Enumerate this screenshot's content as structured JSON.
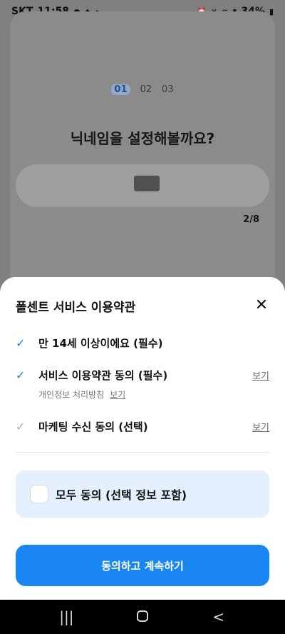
{
  "status_bar": {
    "carrier": "SKT",
    "time": "11:58",
    "battery": "34%"
  },
  "background_page": {
    "steps": [
      "01",
      "02",
      "03"
    ],
    "title": "닉네임을 설정해볼까요?",
    "counter": "2/8"
  },
  "sheet": {
    "title": "폴센트 서비스 이용약관",
    "terms": [
      {
        "label": "만 14세 이상이에요 (필수)",
        "checked": true
      },
      {
        "label": "서비스 이용약관 동의 (필수)",
        "checked": true,
        "view": "보기"
      },
      {
        "label": "마케팅 수신 동의 (선택)",
        "checked": false,
        "view": "보기"
      }
    ],
    "sub_term": {
      "label": "개인정보 처리방침",
      "view": "보기"
    },
    "agree_all_label": "모두 동의 (선택 정보 포함)",
    "continue_label": "동의하고 계속하기"
  },
  "colors": {
    "accent": "#1a86f2",
    "agree_bg": "#e4f0fd"
  }
}
